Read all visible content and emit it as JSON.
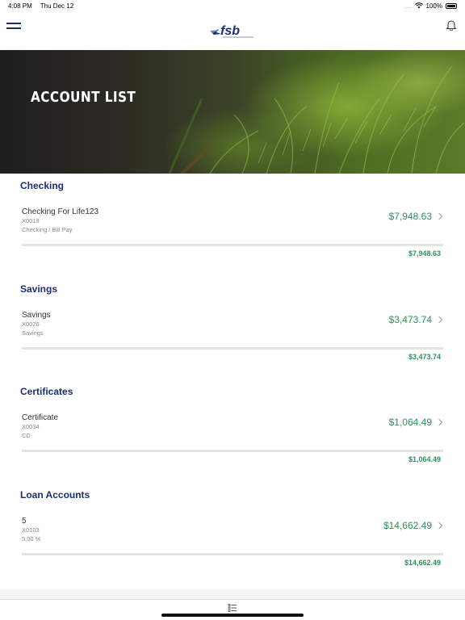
{
  "status_bar": {
    "time": "4:08 PM",
    "date": "Thu Dec 12",
    "signal": "....",
    "battery": "100%"
  },
  "header": {
    "logo_text": "fsb",
    "menu_icon": "hamburger-icon",
    "notification_icon": "bell-icon"
  },
  "hero": {
    "title": "ACCOUNT LIST"
  },
  "colors": {
    "brand_navy": "#1b2f6e",
    "amount_green": "#2f8f5b"
  },
  "sections": [
    {
      "title": "Checking",
      "account": {
        "name": "Checking For Life123",
        "number": "X0018",
        "type": "Checking / Bill Pay",
        "balance": "$7,948.63"
      },
      "total": "$7,948.63"
    },
    {
      "title": "Savings",
      "account": {
        "name": "Savings",
        "number": "X0026",
        "type": "Savings",
        "balance": "$3,473.74"
      },
      "total": "$3,473.74"
    },
    {
      "title": "Certificates",
      "account": {
        "name": "Certificate",
        "number": "X0034",
        "type": "CD",
        "balance": "$1,064.49"
      },
      "total": "$1,064.49"
    },
    {
      "title": "Loan Accounts",
      "account": {
        "name": "5",
        "number": "X0103",
        "type": "5.00 %",
        "balance": "$14,662.49"
      },
      "total": "$14,662.49"
    }
  ],
  "tab_bar": {
    "icon": "list-icon"
  }
}
